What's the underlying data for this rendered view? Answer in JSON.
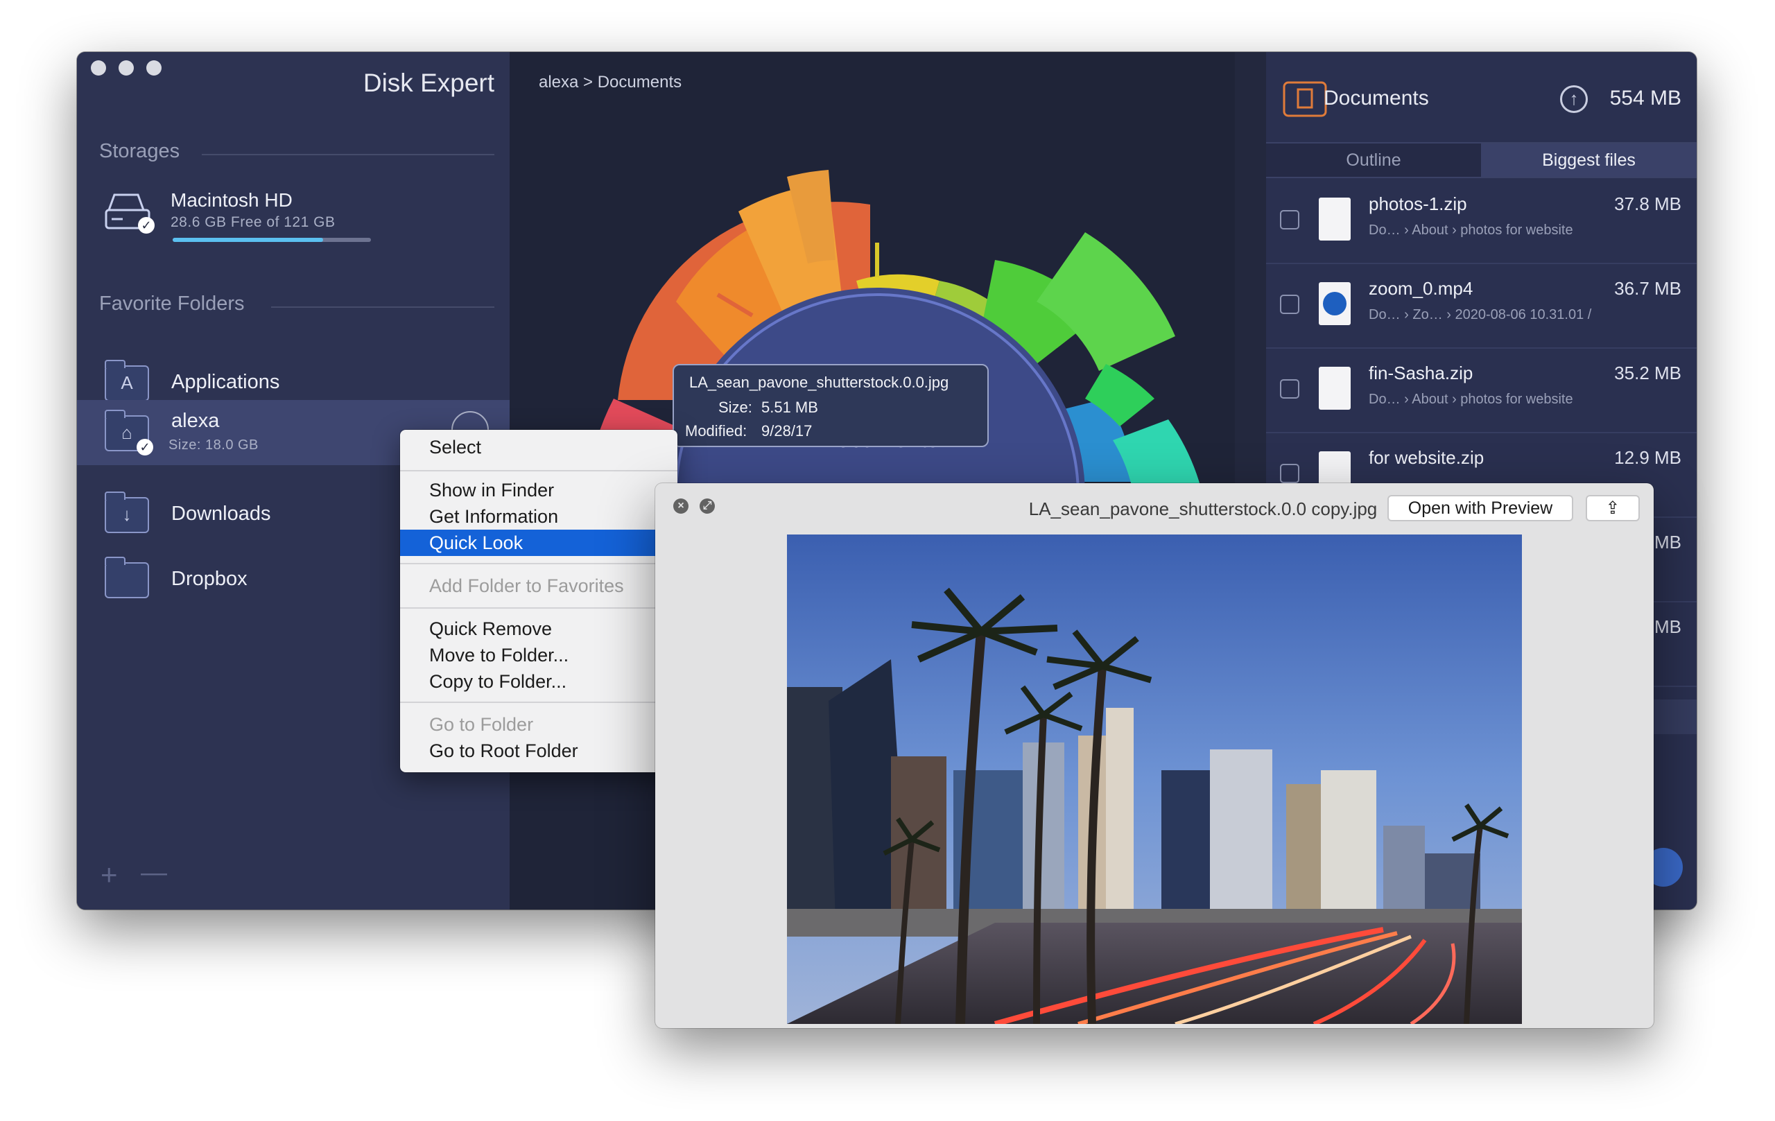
{
  "app": {
    "title": "Disk Expert"
  },
  "sidebar": {
    "storages_label": "Storages",
    "storage": {
      "name": "Macintosh HD",
      "detail": "28.6 GB Free of 121 GB",
      "used_fraction": 0.76
    },
    "favorites_label": "Favorite Folders",
    "favorites": [
      {
        "label": "Applications",
        "sub": "",
        "icon": "apps-folder-icon"
      },
      {
        "label": "alexa",
        "sub": "Size: 18.0 GB",
        "icon": "home-folder-icon"
      },
      {
        "label": "Downloads",
        "sub": "",
        "icon": "downloads-folder-icon"
      },
      {
        "label": "Dropbox",
        "sub": "",
        "icon": "folder-icon"
      }
    ],
    "add_label": "+",
    "remove_label": "—"
  },
  "center": {
    "breadcrumb": "alexa > Documents",
    "chart_center_label": "Documents"
  },
  "tooltip": {
    "filename": "LA_sean_pavone_shutterstock.0.0.jpg",
    "size_label": "Size:",
    "size_value": "5.51 MB",
    "modified_label": "Modified:",
    "modified_value": "9/28/17"
  },
  "right_panel": {
    "folder_name": "Documents",
    "folder_size": "554 MB",
    "tabs": [
      "Outline",
      "Biggest files"
    ],
    "active_tab": "Biggest files",
    "files": [
      {
        "name": "photos-1.zip",
        "size": "37.8 MB",
        "path": [
          "Do…",
          "About",
          "photos for website"
        ],
        "icon": "zip-file-icon"
      },
      {
        "name": "zoom_0.mp4",
        "size": "36.7 MB",
        "path": [
          "Do…",
          "Zo…",
          "2020-08-06 10.31.01 /"
        ],
        "icon": "video-file-icon"
      },
      {
        "name": "fin-Sasha.zip",
        "size": "35.2 MB",
        "path": [
          "Do…",
          "About",
          "photos for website"
        ],
        "icon": "zip-file-icon"
      },
      {
        "name": "for website.zip",
        "size": "12.9 MB",
        "path": [],
        "icon": "zip-file-icon"
      }
    ],
    "partial_sizes": [
      "MB",
      "MB"
    ]
  },
  "context_menu": {
    "groups": [
      [
        {
          "label": "Select",
          "enabled": true
        }
      ],
      [
        {
          "label": "Show in Finder",
          "enabled": true
        },
        {
          "label": "Get Information",
          "enabled": true
        },
        {
          "label": "Quick Look",
          "enabled": true,
          "highlighted": true
        }
      ],
      [
        {
          "label": "Add Folder to Favorites",
          "enabled": false
        }
      ],
      [
        {
          "label": "Quick Remove",
          "enabled": true
        },
        {
          "label": "Move to Folder...",
          "enabled": true
        },
        {
          "label": "Copy to Folder...",
          "enabled": true
        }
      ],
      [
        {
          "label": "Go to Folder",
          "enabled": false
        },
        {
          "label": "Go to Root Folder",
          "enabled": true
        }
      ]
    ]
  },
  "quick_look": {
    "title": "LA_sean_pavone_shutterstock.0.0 copy.jpg",
    "open_button": "Open with Preview",
    "share_icon": "share-icon",
    "close_icon": "close-icon",
    "fullscreen_icon": "fullscreen-icon"
  },
  "colors": {
    "sidebar_bg": "#2d3352",
    "window_bg": "#23283e",
    "accent": "#1462d8",
    "progress": "#5bc0f0"
  }
}
